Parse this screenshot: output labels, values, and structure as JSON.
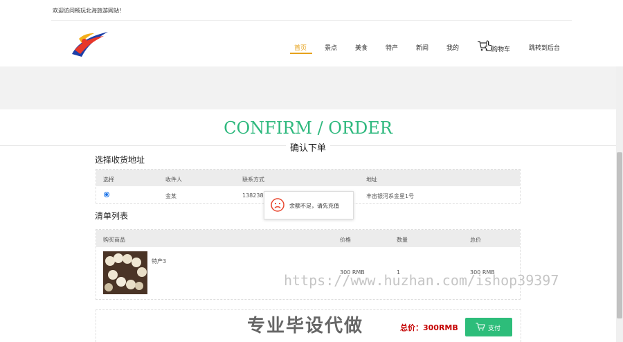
{
  "topbar": {
    "welcome": "欢迎访问畅玩北海旅游网站！"
  },
  "nav": {
    "items": [
      {
        "label": "首页",
        "active": true
      },
      {
        "label": "景点"
      },
      {
        "label": "美食"
      },
      {
        "label": "特产"
      },
      {
        "label": "新闻"
      },
      {
        "label": "我的"
      },
      {
        "label": "购物车"
      },
      {
        "label": "跳转到后台"
      }
    ]
  },
  "page": {
    "title_en": "CONFIRM / ORDER",
    "title_cn": "确认下单"
  },
  "address": {
    "section_title": "选择收货地址",
    "columns": [
      "选择",
      "收件人",
      "联系方式",
      "地址"
    ],
    "rows": [
      {
        "selected": true,
        "name": "金某",
        "phone": "1382385",
        "address": "丰宙银河系金星1号"
      }
    ]
  },
  "cart": {
    "section_title": "清单列表",
    "columns": [
      "购买商品",
      "价格",
      "数量",
      "总价"
    ],
    "rows": [
      {
        "name": "特产3",
        "price": "300 RMB",
        "qty": "1",
        "total": "300 RMB"
      }
    ]
  },
  "toast": {
    "message": "余额不足，请先充值",
    "icon": "sad-face-icon"
  },
  "footer": {
    "total_label": "总价：300RMB",
    "pay_label": "支付"
  },
  "watermarks": {
    "url": "https://www.huzhan.com/ishop39397",
    "cn": "专业毕设代做"
  },
  "colors": {
    "accent": "#e6a21b",
    "green": "#2db87d",
    "pay": "#2dbd7a",
    "price": "#c40000"
  }
}
